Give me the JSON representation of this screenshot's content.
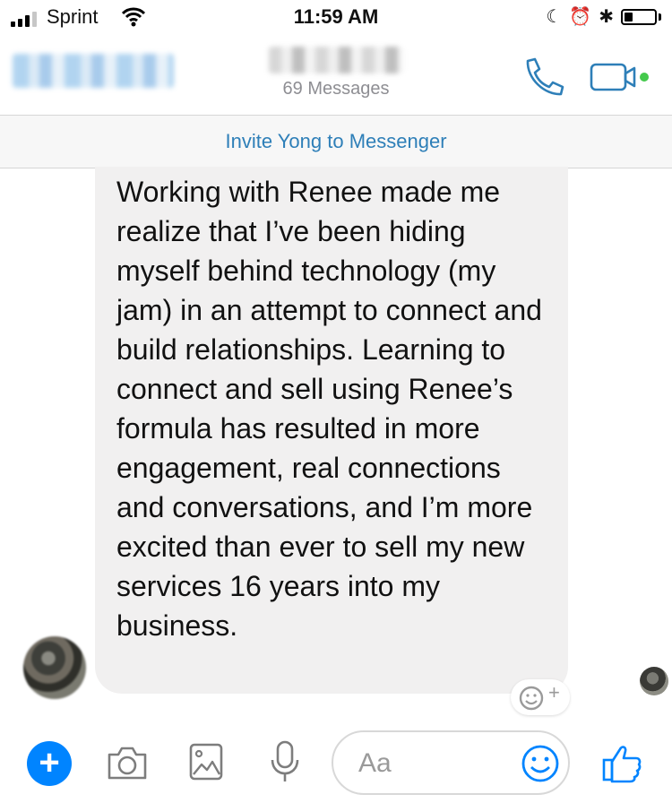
{
  "status_bar": {
    "carrier": "Sprint",
    "time": "11:59 AM"
  },
  "header": {
    "message_count": "69 Messages",
    "accent_color": "#0084ff",
    "icon_color": "#2e7fb8"
  },
  "invite_bar": {
    "label": "Invite Yong to Messenger"
  },
  "message": {
    "text": "Working with Renee made me realize that I’ve been hiding myself behind technology (my jam) in an attempt to connect and build relationships. Learning to connect and sell using Renee’s formula has resulted in more engagement, real connections and conversations, and I’m more excited than ever to sell my new services 16 years into my business."
  },
  "reaction": {
    "plus": "+"
  },
  "composer": {
    "placeholder": "Aa",
    "add_label": "+"
  },
  "icons": [
    "signal-icon",
    "wifi-icon",
    "moon-icon",
    "alarm-icon",
    "bluetooth-icon",
    "battery-icon",
    "phone-icon",
    "video-icon",
    "smiley-icon",
    "camera-icon",
    "gallery-icon",
    "mic-icon",
    "like-icon"
  ]
}
